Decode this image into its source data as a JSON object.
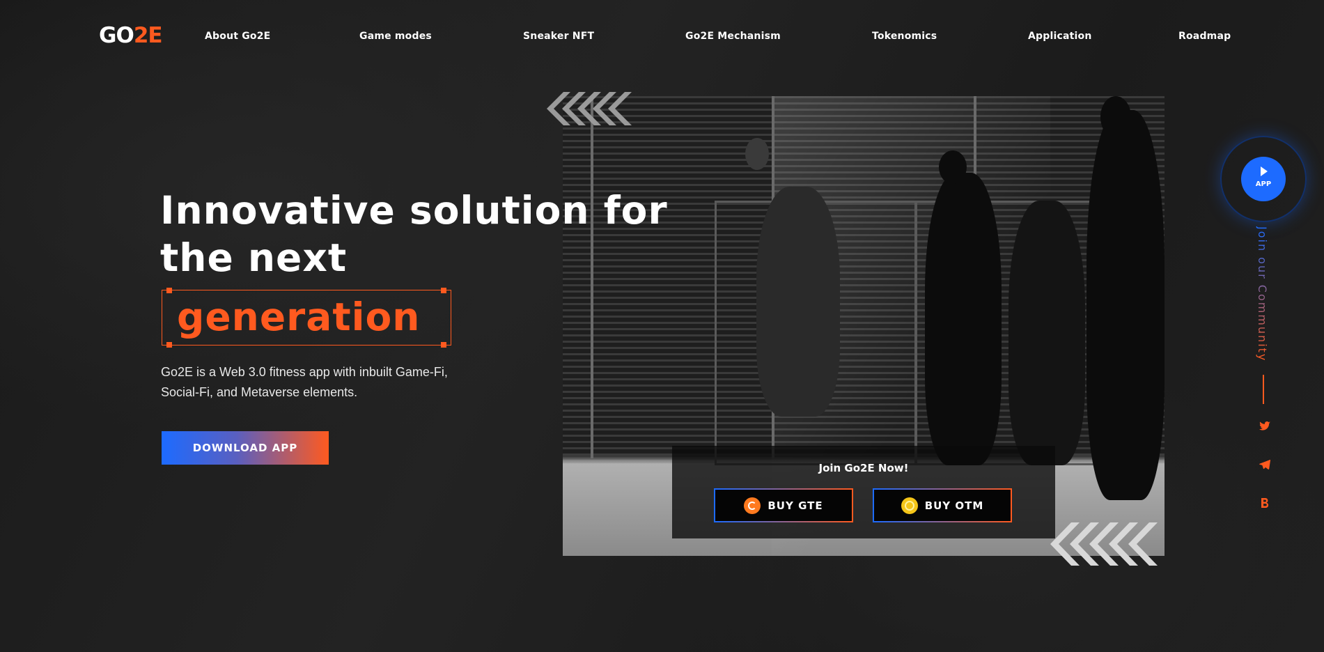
{
  "brand": {
    "logo_main": "GO",
    "logo_accent": "2E"
  },
  "nav": {
    "items": [
      {
        "label": "About Go2E"
      },
      {
        "label": "Game modes"
      },
      {
        "label": "Sneaker NFT"
      },
      {
        "label": "Go2E Mechanism"
      },
      {
        "label": "Tokenomics"
      },
      {
        "label": "Application"
      },
      {
        "label": "Roadmap"
      }
    ]
  },
  "hero": {
    "title_line1": "Innovative solution for",
    "title_line2": "the next",
    "highlight": "generation",
    "description": "Go2E is a Web 3.0 fitness app with inbuilt Game-Fi, Social-Fi, and Metaverse elements.",
    "cta": "DOWNLOAD APP"
  },
  "join": {
    "title": "Join Go2E Now!",
    "buy_gte": "BUY GTE",
    "buy_otm": "BUY OTM"
  },
  "sidebar": {
    "app_label": "APP",
    "community": "Join our Community",
    "socials": [
      "twitter-icon",
      "telegram-icon",
      "medium-icon"
    ]
  },
  "colors": {
    "accent_orange": "#ff5a1f",
    "accent_blue": "#1d6bff",
    "background": "#1c1c1c"
  }
}
